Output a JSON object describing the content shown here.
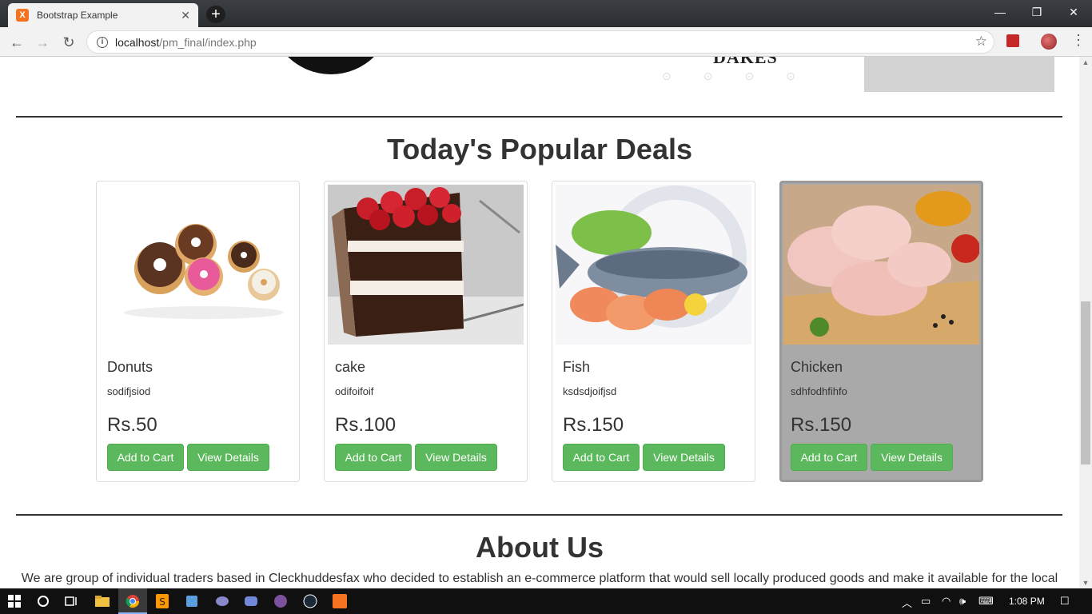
{
  "browser": {
    "tab_title": "Bootstrap Example",
    "tab_favicon": "X",
    "url_host": "localhost",
    "url_path": "/pm_final/index.php",
    "controls": {
      "minimize": "—",
      "restore": "❐",
      "close": "✕"
    }
  },
  "banner": {
    "logo_text": "DAKES"
  },
  "deals": {
    "title": "Today's Popular Deals",
    "products": [
      {
        "name": "Donuts",
        "desc": "sodifjsiod",
        "price": "Rs.50",
        "cart_label": "Add to Cart",
        "view_label": "View Details"
      },
      {
        "name": "cake",
        "desc": "odifoifoif",
        "price": "Rs.100",
        "cart_label": "Add to Cart",
        "view_label": "View Details"
      },
      {
        "name": "Fish",
        "desc": "ksdsdjoifjsd",
        "price": "Rs.150",
        "cart_label": "Add to Cart",
        "view_label": "View Details"
      },
      {
        "name": "Chicken",
        "desc": "sdhfodhfihfo",
        "price": "Rs.150",
        "cart_label": "Add to Cart",
        "view_label": "View Details"
      }
    ]
  },
  "about": {
    "title": "About Us",
    "text": "We are group of individual traders based in Cleckhuddesfax who decided to establish an e-commerce platform that would sell locally produced goods and make it available for the local"
  },
  "taskbar": {
    "time": "1:08 PM"
  },
  "colors": {
    "button": "#5cb85c",
    "heading": "#333333",
    "highlight_card": "#a9a9a9"
  }
}
